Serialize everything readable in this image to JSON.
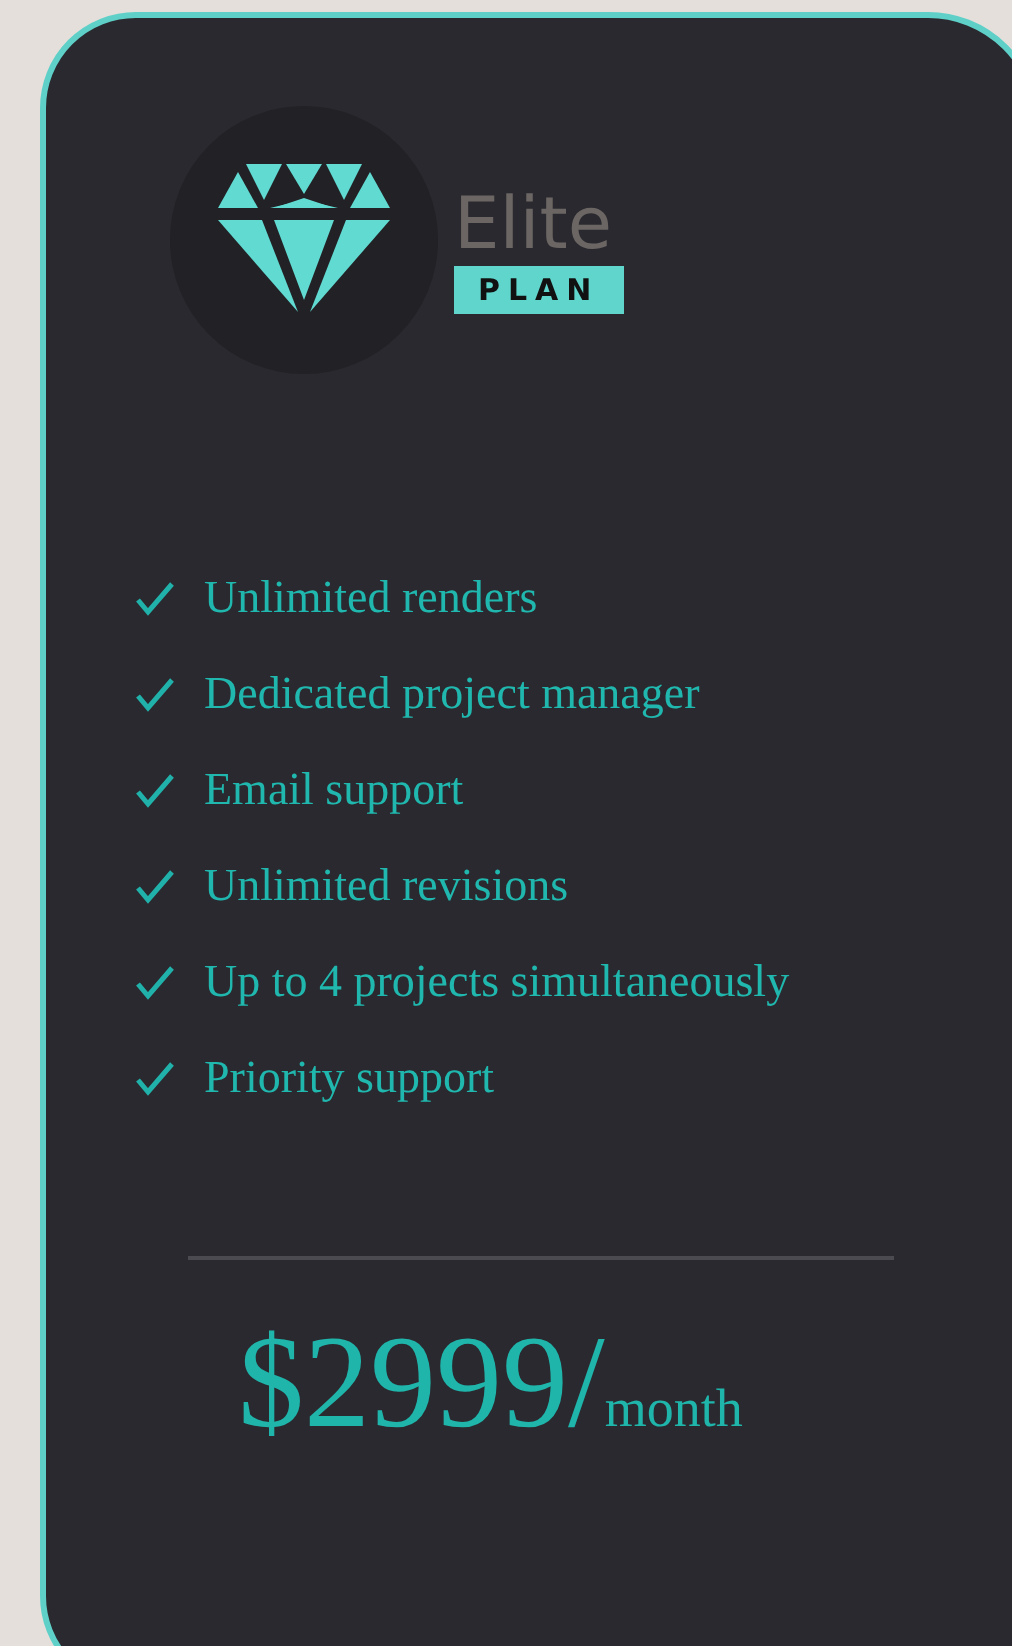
{
  "logo": {
    "title": "Elite",
    "badge": "PLAN"
  },
  "features": [
    {
      "label": "Unlimited renders"
    },
    {
      "label": "Dedicated project manager"
    },
    {
      "label": "Email support"
    },
    {
      "label": "Unlimited revisions"
    },
    {
      "label": "Up to 4 projects simultaneously"
    },
    {
      "label": "Priority support"
    }
  ],
  "price": {
    "amount": "$2999/",
    "period": "month"
  }
}
